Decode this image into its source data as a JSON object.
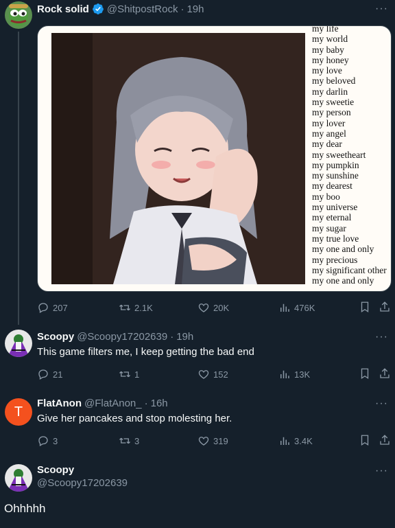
{
  "tweets": [
    {
      "name": "Rock solid",
      "handle": "@ShitpostRock",
      "dot": "·",
      "time": "19h",
      "verified": true,
      "media_text_lines": [
        "my life",
        "my world",
        "my baby",
        "my honey",
        "my love",
        "my beloved",
        "my darlin",
        "my sweetie",
        "my person",
        "my lover",
        "my angel",
        "my dear",
        "my sweetheart",
        "my pumpkin",
        "my sunshine",
        "my dearest",
        "my boo",
        "my universe",
        "my eternal",
        "my sugar",
        "my true love",
        "my one and only",
        "my precious",
        "my significant other",
        "my one and only"
      ],
      "stats": {
        "replies": "207",
        "reposts": "2.1K",
        "likes": "20K",
        "views": "476K"
      }
    },
    {
      "name": "Scoopy",
      "handle": "@Scoopy17202639",
      "dot": "·",
      "time": "19h",
      "text": "This game filters me, I keep getting the bad end",
      "stats": {
        "replies": "21",
        "reposts": "1",
        "likes": "152",
        "views": "13K"
      }
    },
    {
      "name": "FlatAnon",
      "handle": "@FlatAnon_",
      "dot": "·",
      "time": "16h",
      "avatar_letter": "T",
      "text": "Give her pancakes and stop molesting her.",
      "stats": {
        "replies": "3",
        "reposts": "3",
        "likes": "319",
        "views": "3.4K"
      }
    },
    {
      "name": "Scoopy",
      "handle": "@Scoopy17202639",
      "text": "Ohhhhh"
    }
  ],
  "more_icon": "···",
  "colors": {
    "background": "#15202b",
    "secondary_text": "#8b98a5",
    "verified": "#1d9bf0",
    "avatar_orange": "#f4511e",
    "divider": "#38444d"
  },
  "icons": {
    "reply": "reply-icon",
    "repost": "repost-icon",
    "like": "like-icon",
    "views": "views-icon",
    "bookmark": "bookmark-icon",
    "share": "share-icon"
  }
}
